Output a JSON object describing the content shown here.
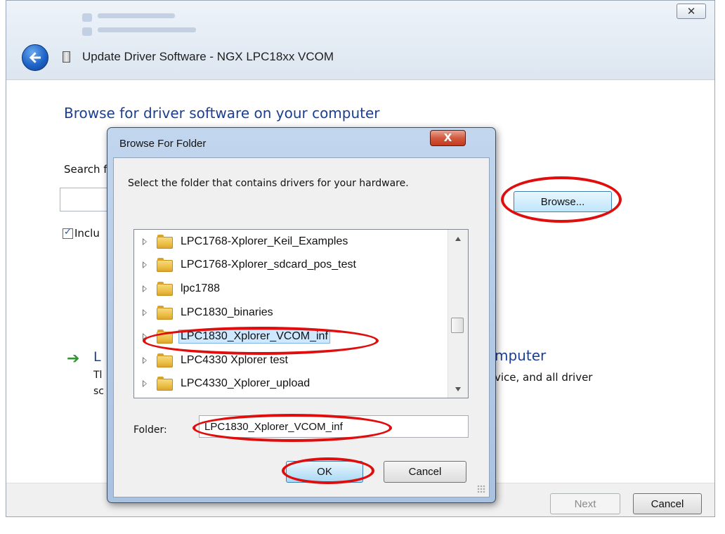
{
  "wizard": {
    "close_glyph": "✕",
    "window_title": "Update Driver Software - NGX LPC18xx VCOM",
    "heading": "Browse for driver software on your computer",
    "search_label_fragment": "Search f",
    "include_label_fragment": "Inclu",
    "browse_button": "Browse...",
    "option_title_fragment_left": "L",
    "option_title_fragment_right": "mputer",
    "option_desc_fragment_left": "Tl",
    "option_desc_fragment_left2": "sc",
    "option_desc_fragment_right": "vice, and all driver",
    "next_button": "Next",
    "cancel_button": "Cancel"
  },
  "dialog": {
    "title": "Browse For Folder",
    "close_glyph": "X",
    "instruction": "Select the folder that contains drivers for your hardware.",
    "folders": [
      {
        "label": "LPC1768-Xplorer_Keil_Examples",
        "selected": false
      },
      {
        "label": "LPC1768-Xplorer_sdcard_pos_test",
        "selected": false
      },
      {
        "label": "lpc1788",
        "selected": false
      },
      {
        "label": "LPC1830_binaries",
        "selected": false
      },
      {
        "label": "LPC1830_Xplorer_VCOM_inf",
        "selected": true
      },
      {
        "label": "LPC4330 Xplorer test",
        "selected": false
      },
      {
        "label": "LPC4330_Xplorer_upload",
        "selected": false
      }
    ],
    "folder_label": "Folder:",
    "folder_value": "LPC1830_Xplorer_VCOM_inf",
    "ok_button": "OK",
    "cancel_button": "Cancel"
  },
  "colors": {
    "annotation_red": "#e00d0d",
    "heading_blue": "#1b3f94",
    "selection_bg": "#cde8ff"
  }
}
